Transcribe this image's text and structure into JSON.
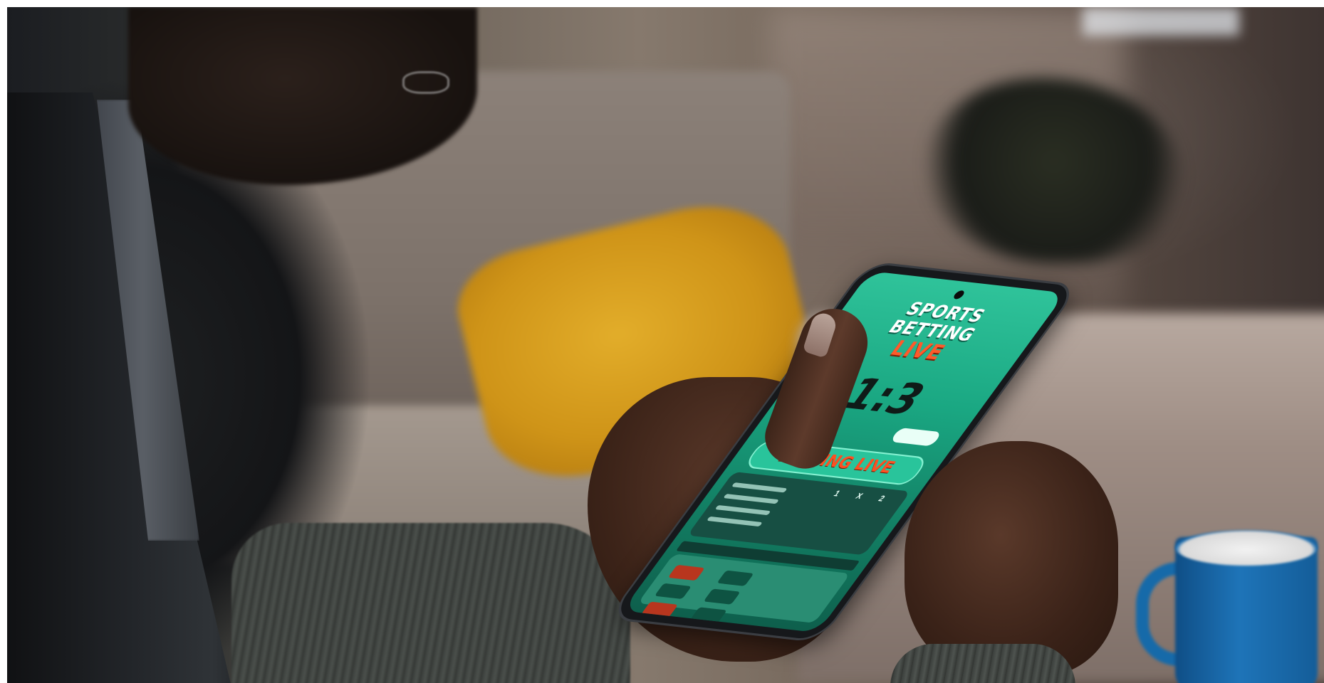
{
  "photo": {
    "subject": "",
    "phone_screen": {
      "headline": [
        "SPORTS",
        "BETTING",
        "LIVE"
      ],
      "score": "1:3",
      "banner": "BETTING LIVE",
      "columns": [
        "1",
        "X",
        "2"
      ]
    }
  },
  "colors": {
    "screen_green": "#1aa782",
    "accent_orange": "#ff5a2a",
    "pillow_yellow": "#d49a1c",
    "mug_blue": "#1e74b8"
  }
}
